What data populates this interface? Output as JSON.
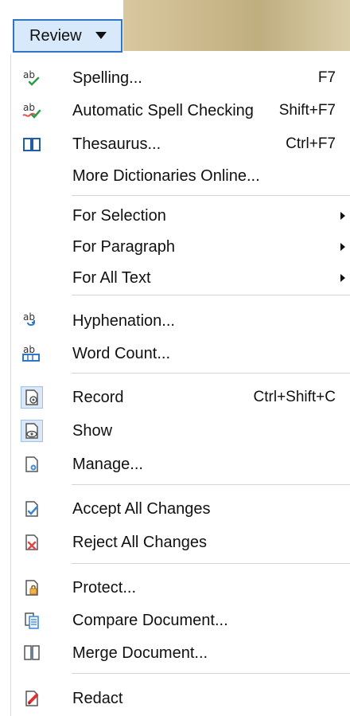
{
  "review_button": {
    "label": "Review"
  },
  "menu": {
    "items": [
      {
        "label": "Spelling...",
        "shortcut": "F7"
      },
      {
        "label": "Automatic Spell Checking",
        "shortcut": "Shift+F7"
      },
      {
        "label": "Thesaurus...",
        "shortcut": "Ctrl+F7"
      },
      {
        "label": "More Dictionaries Online...",
        "shortcut": ""
      },
      {
        "label": "For Selection",
        "shortcut": ""
      },
      {
        "label": "For Paragraph",
        "shortcut": ""
      },
      {
        "label": "For All Text",
        "shortcut": ""
      },
      {
        "label": "Hyphenation...",
        "shortcut": ""
      },
      {
        "label": "Word Count...",
        "shortcut": ""
      },
      {
        "label": "Record",
        "shortcut": "Ctrl+Shift+C"
      },
      {
        "label": "Show",
        "shortcut": ""
      },
      {
        "label": "Manage...",
        "shortcut": ""
      },
      {
        "label": "Accept All Changes",
        "shortcut": ""
      },
      {
        "label": "Reject All Changes",
        "shortcut": ""
      },
      {
        "label": "Protect...",
        "shortcut": ""
      },
      {
        "label": "Compare Document...",
        "shortcut": ""
      },
      {
        "label": "Merge Document...",
        "shortcut": ""
      },
      {
        "label": "Redact",
        "shortcut": ""
      }
    ]
  },
  "icons": {
    "spelling": "spelling-icon",
    "auto_spell": "automatic-spell-checking-icon",
    "thesaurus": "thesaurus-icon",
    "hyphenation": "hyphenation-icon",
    "word_count": "word-count-icon",
    "record": "record-changes-icon",
    "show": "show-changes-icon",
    "manage": "manage-changes-icon",
    "accept": "accept-changes-icon",
    "reject": "reject-changes-icon",
    "protect": "protect-icon",
    "compare": "compare-document-icon",
    "merge": "merge-document-icon",
    "redact": "redact-icon"
  },
  "colors": {
    "button_border": "#2f74c7",
    "button_fill": "#d8e9fb",
    "active_icon_fill": "#dbe8f7",
    "separator": "#d6d6d6"
  }
}
